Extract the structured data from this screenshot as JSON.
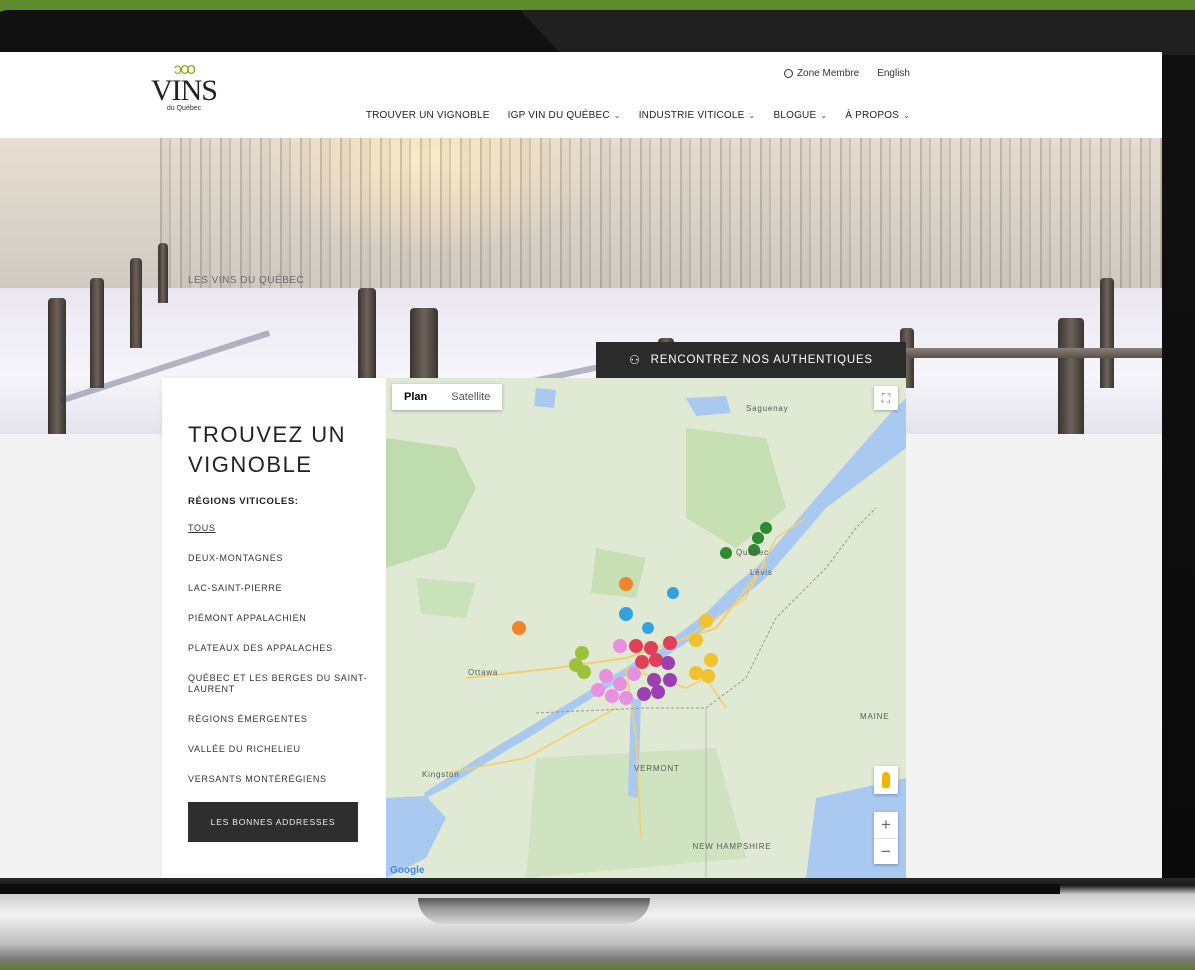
{
  "header": {
    "logo": {
      "main": "VINS",
      "sub": "du Québec"
    },
    "member_link": "Zone Membre",
    "language_link": "English",
    "nav": [
      {
        "label": "TROUVER UN VIGNOBLE",
        "has_menu": false
      },
      {
        "label": "IGP VIN DU QUÉBEC",
        "has_menu": true
      },
      {
        "label": "INDUSTRIE VITICOLE",
        "has_menu": true
      },
      {
        "label": "BLOGUE",
        "has_menu": true
      },
      {
        "label": "À PROPOS",
        "has_menu": true
      }
    ]
  },
  "hero": {
    "label": "LES VINS DU QUÉBEC",
    "cta": "RENCONTREZ NOS AUTHENTIQUES",
    "cta_icon": "people-icon"
  },
  "finder": {
    "title": "TROUVEZ UN VIGNOBLE",
    "regions_label": "RÉGIONS VITICOLES:",
    "regions": [
      "TOUS",
      "DEUX-MONTAGNES",
      "LAC-SAINT-PIERRE",
      "PIÉMONT APPALACHIEN",
      "PLATEAUX DES APPALACHES",
      "QUÉBEC ET LES BERGES DU SAINT-LAURENT",
      "RÉGIONS ÉMERGENTES",
      "VALLÉE DU RICHELIEU",
      "VERSANTS MONTÉRÉGIENS"
    ],
    "active_region": "TOUS",
    "button": "LES BONNES ADDRESSES"
  },
  "map": {
    "toggle": [
      "Plan",
      "Satellite"
    ],
    "selected": "Plan",
    "labels": {
      "ottawa": "Ottawa",
      "vermont": "VERMONT",
      "maine": "MAINE",
      "new_hampshire": "NEW HAMPSHIRE",
      "kingston": "Kingston",
      "quebec": "Québec",
      "levis": "Lévis",
      "saguenay": "Saguenay"
    },
    "zoom_in": "+",
    "zoom_out": "−",
    "attribution": "Google",
    "colors": {
      "water": "#a9c9f0",
      "land": "#dfe9d4",
      "forest": "#bfdcae",
      "marker_green": "#2e8b2e",
      "marker_orange": "#f0852a",
      "marker_blue": "#33a3e0",
      "marker_red": "#e0405a",
      "marker_pink": "#e890e0",
      "marker_purple": "#9b3fb5",
      "marker_yellow": "#f2c12e",
      "marker_lime": "#9bc23a"
    }
  },
  "colors": {
    "background_green": "#5a7f2a",
    "accent": "#8ab02a",
    "dark_button": "#2b2b2b"
  }
}
